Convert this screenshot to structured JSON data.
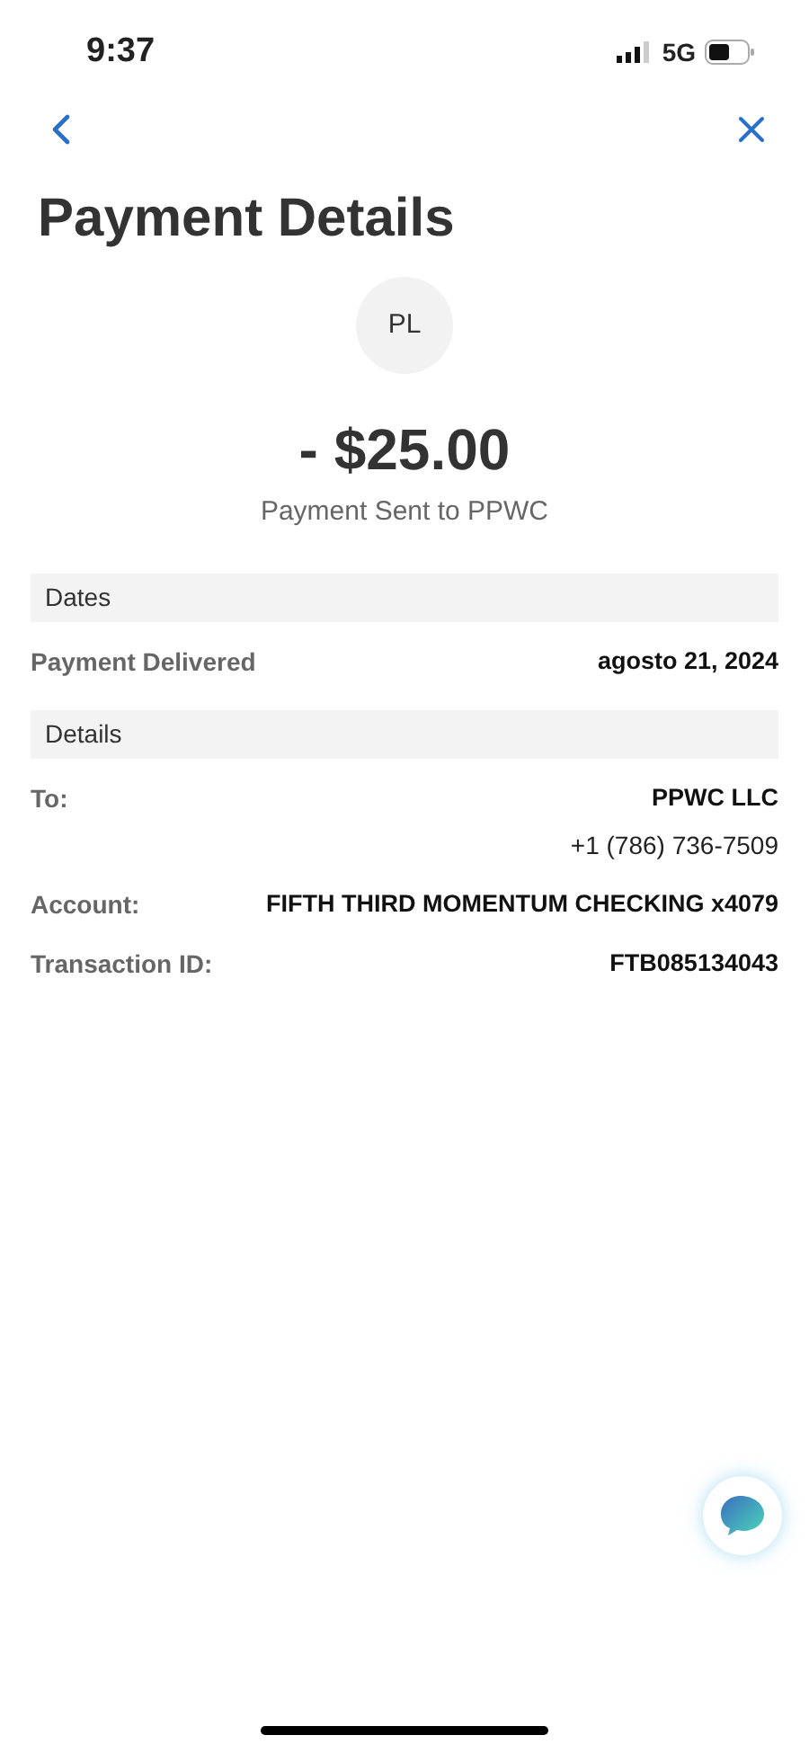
{
  "status_bar": {
    "time": "9:37",
    "network": "5G"
  },
  "title": "Payment Details",
  "avatar": {
    "initials": "PL"
  },
  "amount": "- $25.00",
  "subtitle": "Payment Sent to PPWC",
  "sections": [
    {
      "header": "Dates",
      "rows": [
        {
          "label": "Payment Delivered",
          "values": [
            "agosto 21, 2024"
          ]
        }
      ]
    },
    {
      "header": "Details",
      "rows": [
        {
          "label": "To:",
          "values": [
            "PPWC LLC",
            "+1 (786) 736-7509"
          ]
        },
        {
          "label": "Account:",
          "values": [
            "FIFTH THIRD MOMENTUM CHECKING x4079"
          ]
        },
        {
          "label": "Transaction ID:",
          "values": [
            "FTB085134043"
          ]
        }
      ]
    }
  ]
}
